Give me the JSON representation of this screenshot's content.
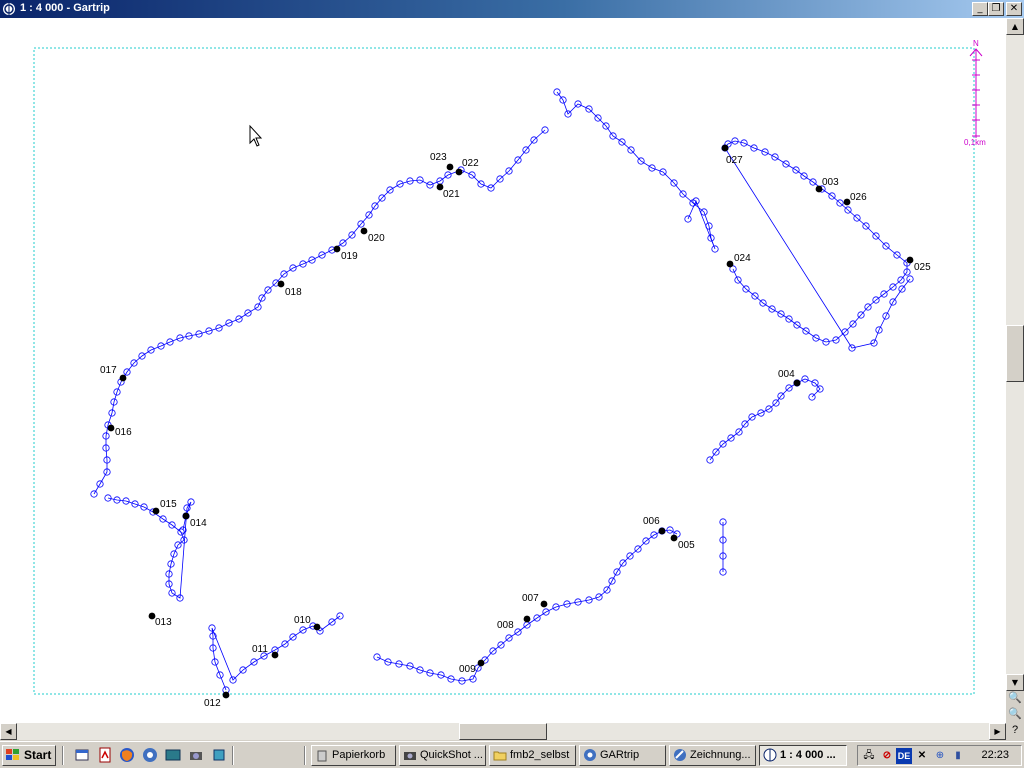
{
  "window": {
    "title": "1 : 4 000 - Gartrip",
    "minimize_glyph": "_",
    "restore_glyph": "❐",
    "close_glyph": "✕"
  },
  "map": {
    "track_color": "#0000ff",
    "waypoint_color": "#000000",
    "frame_color": "#22cccc",
    "north_label": "N",
    "scale_label": "0,1km",
    "scale_color": "#cc00cc",
    "waypoints": [
      {
        "label": "003"
      },
      {
        "label": "004"
      },
      {
        "label": "005"
      },
      {
        "label": "006"
      },
      {
        "label": "007"
      },
      {
        "label": "008"
      },
      {
        "label": "009"
      },
      {
        "label": "010"
      },
      {
        "label": "011"
      },
      {
        "label": "012"
      },
      {
        "label": "013"
      },
      {
        "label": "014"
      },
      {
        "label": "015"
      },
      {
        "label": "016"
      },
      {
        "label": "017"
      },
      {
        "label": "018"
      },
      {
        "label": "019"
      },
      {
        "label": "020"
      },
      {
        "label": "021"
      },
      {
        "label": "022"
      },
      {
        "label": "023"
      },
      {
        "label": "024"
      },
      {
        "label": "025"
      },
      {
        "label": "026"
      },
      {
        "label": "027"
      }
    ]
  },
  "taskbar": {
    "start_label": "Start",
    "tasks": [
      {
        "label": "Papierkorb",
        "active": false
      },
      {
        "label": "QuickShot ...",
        "active": false
      },
      {
        "label": "fmb2_selbst",
        "active": false
      },
      {
        "label": "GARtrip",
        "active": false
      },
      {
        "label": "Zeichnung...",
        "active": false
      },
      {
        "label": "1 : 4 000 ...",
        "active": true
      }
    ],
    "tray_language": "DE",
    "clock": "22:23"
  }
}
